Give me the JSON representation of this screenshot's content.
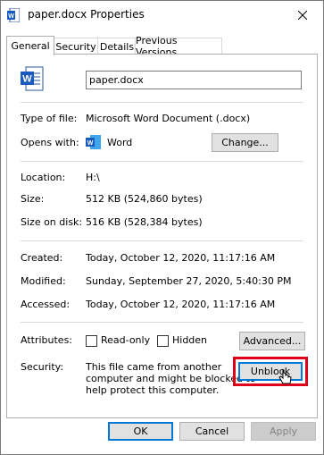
{
  "window": {
    "title": "paper.docx Properties"
  },
  "tabs": [
    {
      "label": "General"
    },
    {
      "label": "Security"
    },
    {
      "label": "Details"
    },
    {
      "label": "Previous Versions"
    }
  ],
  "general": {
    "filename": "paper.docx",
    "type_label": "Type of file:",
    "type_value": "Microsoft Word Document (.docx)",
    "opens_label": "Opens with:",
    "opens_value": "Word",
    "change_button": "Change...",
    "location_label": "Location:",
    "location_value": "H:\\",
    "size_label": "Size:",
    "size_value": "512 KB (524,860 bytes)",
    "size_disk_label": "Size on disk:",
    "size_disk_value": "516 KB (528,384 bytes)",
    "created_label": "Created:",
    "created_value": "Today, October 12, 2020, 11:17:16 AM",
    "modified_label": "Modified:",
    "modified_value": "Sunday, September 27, 2020, 5:40:30 PM",
    "accessed_label": "Accessed:",
    "accessed_value": "Today, October 12, 2020, 11:17:16 AM",
    "attributes_label": "Attributes:",
    "readonly_label": "Read-only",
    "hidden_label": "Hidden",
    "advanced_button": "Advanced...",
    "security_label": "Security:",
    "security_text_1": "This file came from another",
    "security_text_2": "computer and might be blocked to",
    "security_text_3": "help protect this computer.",
    "unblock_button": "Unblock"
  },
  "footer": {
    "ok": "OK",
    "cancel": "Cancel",
    "apply": "Apply"
  },
  "colors": {
    "word_blue": "#185abd",
    "highlight_red": "#e0001b",
    "focus_blue": "#0078d7"
  }
}
